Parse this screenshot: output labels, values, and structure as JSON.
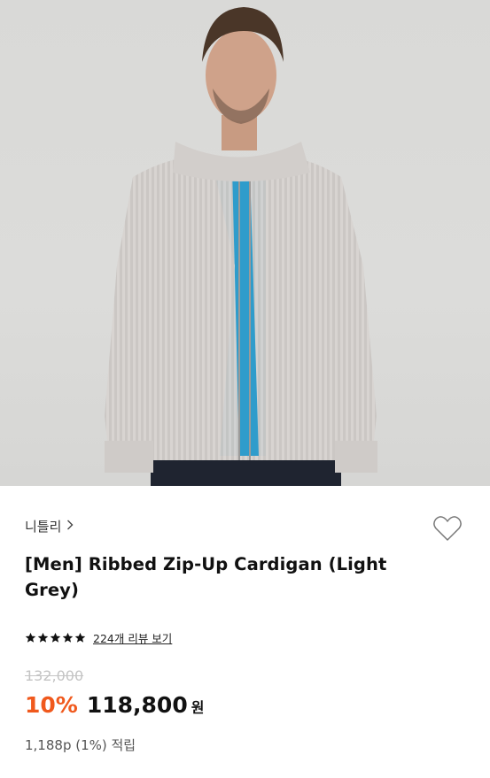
{
  "product": {
    "brand": "니틀리",
    "title": "[Men] Ribbed Zip-Up Cardigan (Light Grey)",
    "rating_stars": 5,
    "review_link": "224개 리뷰 보기",
    "original_price": "132,000",
    "discount": "10%",
    "sale_price": "118,800",
    "currency": "원",
    "points": "1,188p (1%) 적립"
  },
  "icons": {
    "brand_chevron": "chevron-right-icon",
    "wishlist": "heart-outline-icon",
    "star": "star-filled-icon"
  },
  "colors": {
    "discount": "#f0591d",
    "star": "#111111",
    "muted_price": "#c4c4c4"
  }
}
